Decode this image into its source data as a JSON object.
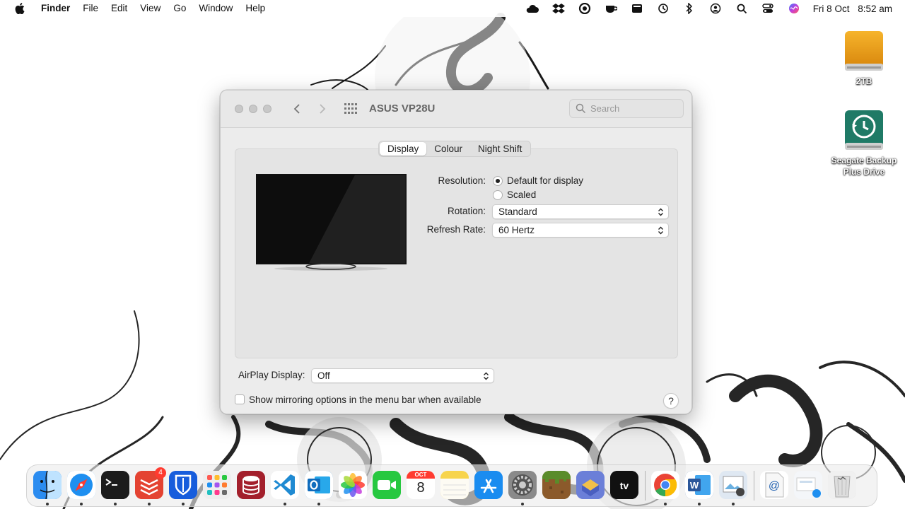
{
  "menubar": {
    "app_name": "Finder",
    "menus": [
      "File",
      "Edit",
      "View",
      "Go",
      "Window",
      "Help"
    ],
    "status_icons": [
      "cloud-icon",
      "dropbox-icon",
      "creative-cloud-icon",
      "coffee-icon",
      "clapper-icon",
      "time-machine-icon",
      "bluetooth-icon",
      "user-icon",
      "search-icon",
      "control-center-icon",
      "siri-icon"
    ],
    "date": "Fri 8 Oct",
    "time": "8:52 am"
  },
  "desktop": {
    "icons": [
      {
        "label": "2TB",
        "icon": "external-drive-icon",
        "color": "#f0a020"
      },
      {
        "label": "Seagate Backup Plus Drive",
        "icon": "time-machine-drive-icon",
        "color": "#1f7a66"
      }
    ]
  },
  "window": {
    "title": "ASUS VP28U",
    "search": {
      "placeholder": "Search",
      "value": ""
    },
    "tabs": [
      {
        "label": "Display",
        "active": true
      },
      {
        "label": "Colour",
        "active": false
      },
      {
        "label": "Night Shift",
        "active": false
      }
    ],
    "resolution": {
      "label": "Resolution:",
      "options": [
        {
          "label": "Default for display",
          "selected": true
        },
        {
          "label": "Scaled",
          "selected": false
        }
      ]
    },
    "rotation": {
      "label": "Rotation:",
      "value": "Standard"
    },
    "refresh_rate": {
      "label": "Refresh Rate:",
      "value": "60 Hertz"
    },
    "airplay": {
      "label": "AirPlay Display:",
      "value": "Off"
    },
    "mirroring": {
      "label": "Show mirroring options in the menu bar when available",
      "checked": false
    },
    "help_label": "?"
  },
  "dock": {
    "apps": [
      {
        "name": "Finder",
        "icon": "finder-icon",
        "color": "#2b8cf0",
        "running": true
      },
      {
        "name": "Safari",
        "icon": "safari-icon",
        "color": "#1e8ff0",
        "running": true
      },
      {
        "name": "Terminal",
        "icon": "terminal-icon",
        "color": "#1b1b1b",
        "running": true
      },
      {
        "name": "Todoist",
        "icon": "todoist-icon",
        "color": "#e44332",
        "running": true,
        "badge": "4"
      },
      {
        "name": "Bitwarden",
        "icon": "bitwarden-icon",
        "color": "#175ddc",
        "running": true
      },
      {
        "name": "Launchpad",
        "icon": "launchpad-icon",
        "color": "#e9e9e9",
        "running": false
      },
      {
        "name": "Sequel",
        "icon": "database-icon",
        "color": "#a3202c",
        "running": false
      },
      {
        "name": "Visual Studio Code",
        "icon": "vscode-icon",
        "color": "#ffffff",
        "running": true
      },
      {
        "name": "Outlook",
        "icon": "outlook-icon",
        "color": "#0f6cbd",
        "running": true
      },
      {
        "name": "Photos",
        "icon": "photos-icon",
        "color": "#ffffff",
        "running": false
      },
      {
        "name": "FaceTime",
        "icon": "facetime-icon",
        "color": "#27c840",
        "running": false
      },
      {
        "name": "Calendar",
        "icon": "calendar-icon",
        "color": "#ffffff",
        "running": false,
        "month": "OCT",
        "day": "8"
      },
      {
        "name": "Notes",
        "icon": "notes-icon",
        "color": "#f7d44c",
        "running": false
      },
      {
        "name": "App Store",
        "icon": "app-store-icon",
        "color": "#1a8cf0",
        "running": false
      },
      {
        "name": "System Preferences",
        "icon": "gear-icon",
        "color": "#8a8a8a",
        "running": true
      },
      {
        "name": "Minecraft",
        "icon": "minecraft-icon",
        "color": "#5a8c2a",
        "running": false
      },
      {
        "name": "Dropzone",
        "icon": "dropzone-icon",
        "color": "#6b7fd8",
        "running": false
      },
      {
        "name": "Apple TV",
        "icon": "apple-tv-icon",
        "color": "#111111",
        "running": false,
        "text": "tv"
      },
      {
        "name": "Google Chrome",
        "icon": "chrome-icon",
        "color": "#ffffff",
        "running": true
      },
      {
        "name": "Microsoft Word",
        "icon": "word-icon",
        "color": "#2b579a",
        "running": true
      },
      {
        "name": "Preview",
        "icon": "preview-icon",
        "color": "#dfe8f2",
        "running": true
      },
      {
        "name": "Internet Location",
        "icon": "http-file-icon",
        "color": "#f2f2f2",
        "running": false
      },
      {
        "name": "Downloads",
        "icon": "downloads-stack-icon",
        "color": "#e8eef6",
        "running": false
      },
      {
        "name": "Trash",
        "icon": "trash-icon",
        "color": "#d8d8d8",
        "running": false
      }
    ]
  }
}
